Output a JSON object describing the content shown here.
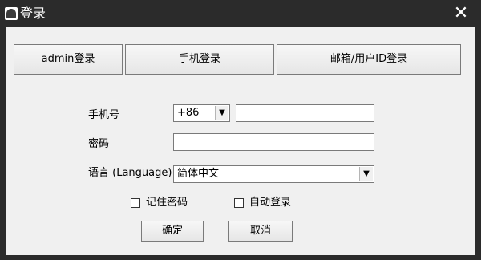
{
  "window": {
    "title": "登录"
  },
  "tabs": [
    {
      "label": "admin登录"
    },
    {
      "label": "手机登录"
    },
    {
      "label": "邮箱/用户ID登录"
    }
  ],
  "form": {
    "phone_label": "手机号",
    "country_code": "+86",
    "phone_value": "",
    "password_label": "密码",
    "password_value": "",
    "language_label": "语言 (Language)",
    "language_value": "简体中文",
    "remember_label": "记住密码",
    "auto_login_label": "自动登录",
    "remember_checked": false,
    "auto_login_checked": false
  },
  "buttons": {
    "ok": "确定",
    "cancel": "取消"
  }
}
